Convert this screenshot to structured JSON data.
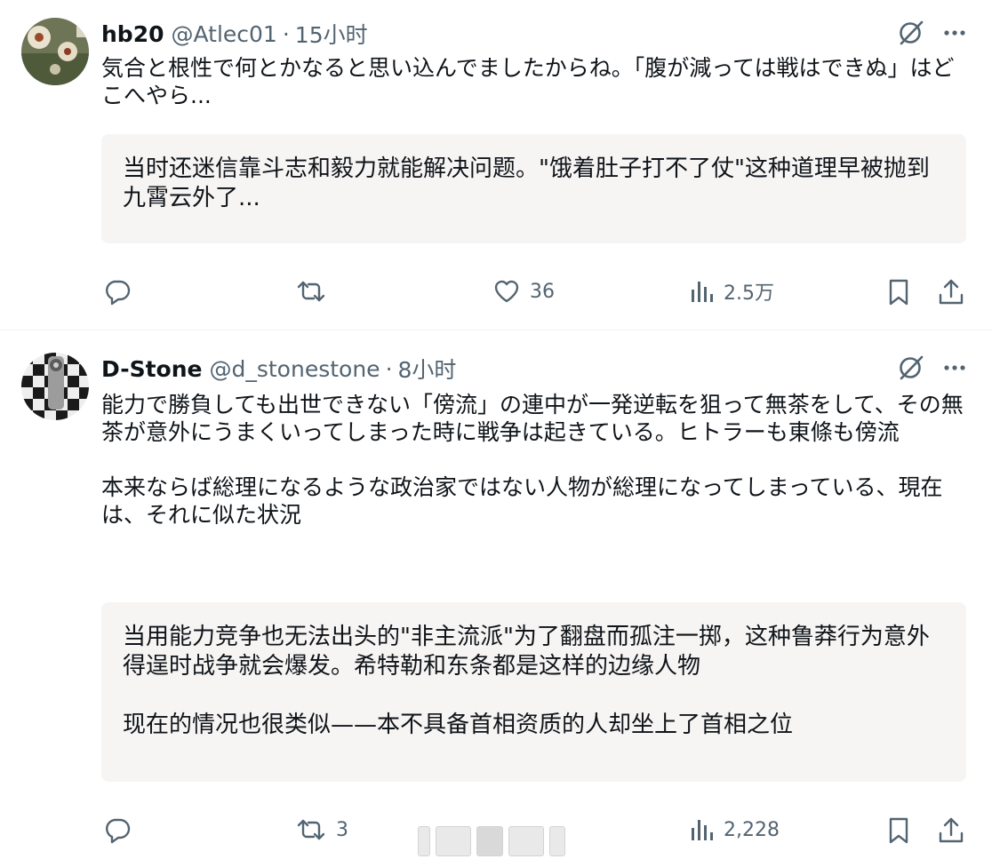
{
  "tweet1": {
    "display_name": "hb20",
    "handle": "@Atlec01",
    "separator": "·",
    "time": "15小时",
    "text": "気合と根性で何とかなると思い込んでましたからね。「腹が減っては戦はできぬ」はどこへやら...",
    "translation": "当时还迷信靠斗志和毅力就能解决问题。\"饿着肚子打不了仗\"这种道理早被抛到九霄云外了...",
    "stats": {
      "replies": "",
      "retweets": "",
      "likes": "36",
      "views": "2.5万"
    }
  },
  "tweet2": {
    "display_name": "D-Stone",
    "handle": "@d_stonestone",
    "separator": "·",
    "time": "8小时",
    "text_paragraphs": [
      "能力で勝負しても出世できない「傍流」の連中が一発逆転を狙って無茶をして、その無茶が意外にうまくいってしまった時に戦争は起きている。ヒトラーも東條も傍流",
      "本来ならば総理になるような政治家ではない人物が総理になってしまっている、現在は、それに似た状況"
    ],
    "translation_paragraphs": [
      "当用能力竞争也无法出头的\"非主流派\"为了翻盘而孤注一掷，这种鲁莽行为意外得逞时战争就会爆发。希特勒和东条都是这样的边缘人物",
      "现在的情况也很类似——本不具备首相资质的人却坐上了首相之位"
    ],
    "stats": {
      "replies": "",
      "retweets": "3",
      "likes": "",
      "views": "2,228"
    }
  },
  "icons": [
    "grok-icon",
    "more-icon",
    "reply-icon",
    "retweet-icon",
    "like-icon",
    "views-icon",
    "bookmark-icon",
    "share-icon"
  ],
  "colors": {
    "text": "#0f1419",
    "secondary": "#536471",
    "translation_bg": "#f7f5f4",
    "divider": "#eff3f4"
  }
}
